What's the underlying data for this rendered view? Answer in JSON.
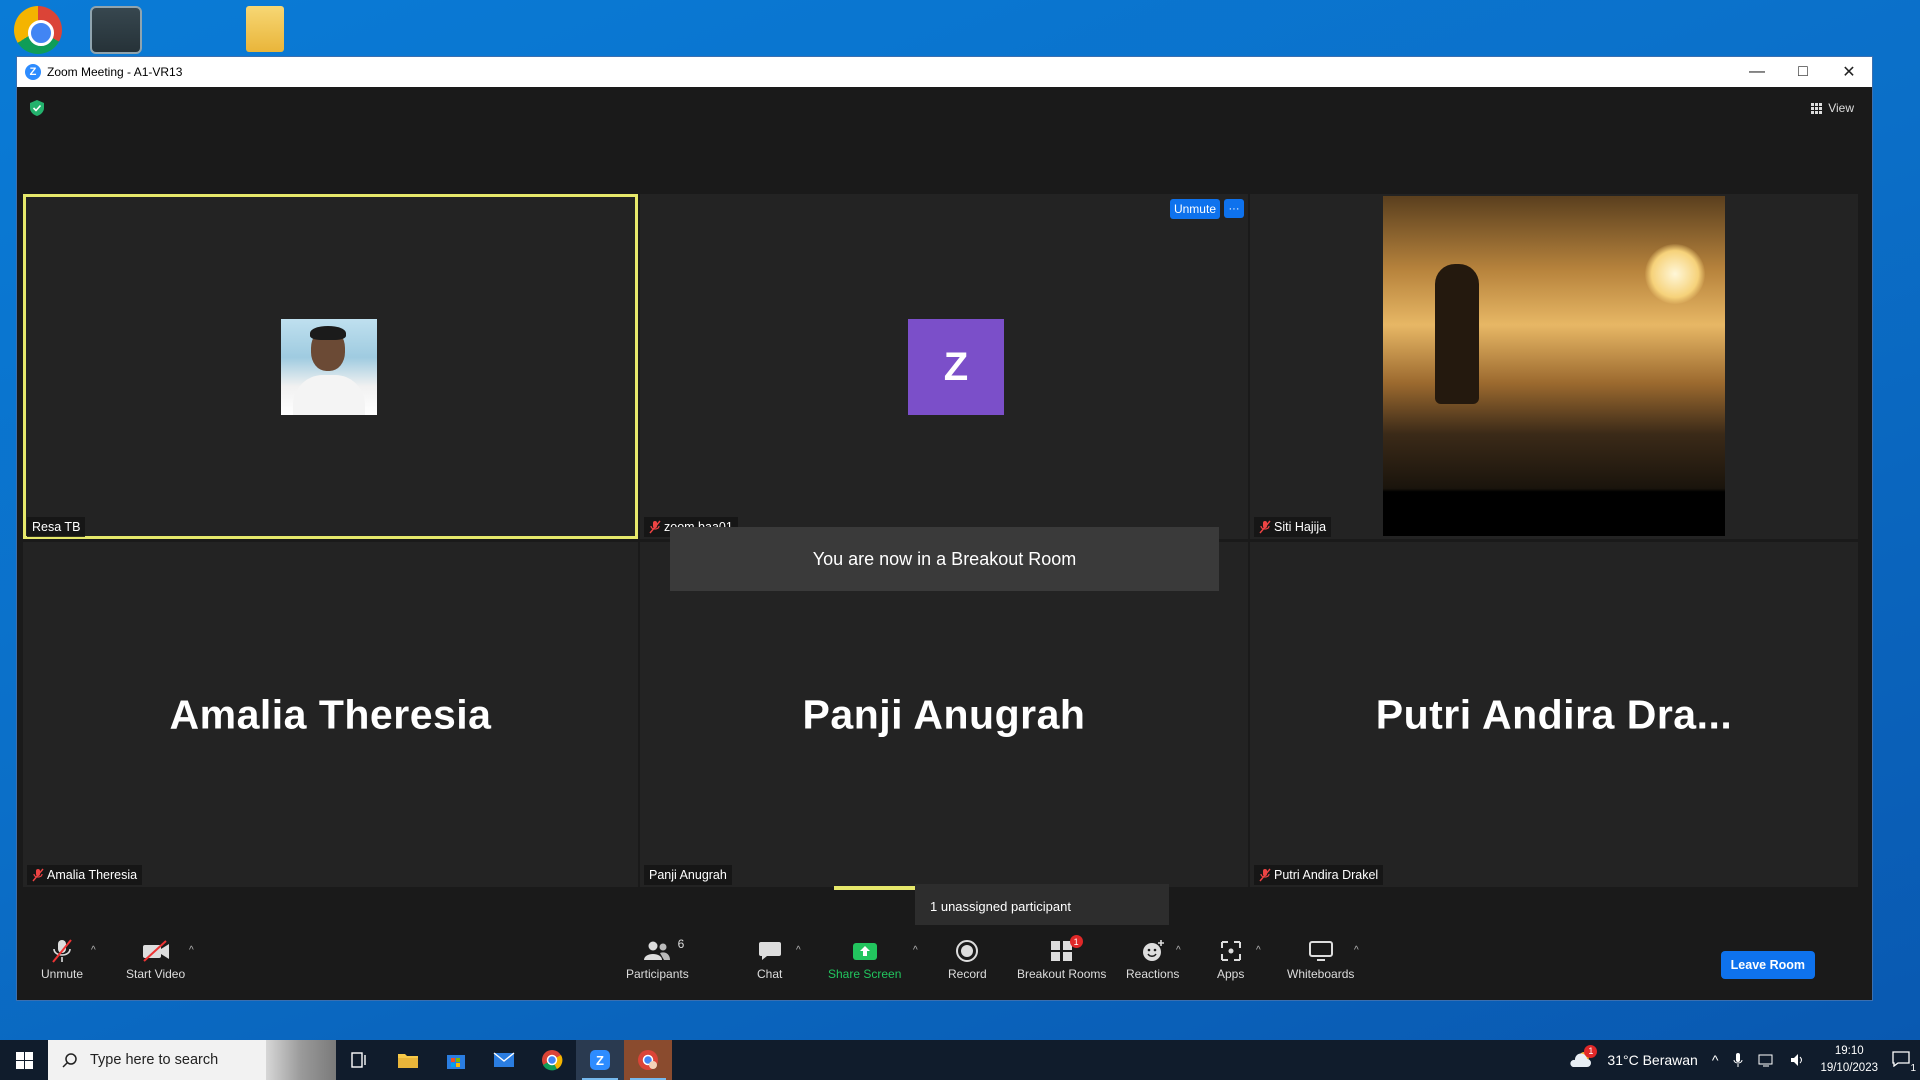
{
  "window": {
    "title": "Zoom Meeting - A1-VR13",
    "minimize": "—",
    "maximize": "□",
    "close": "✕"
  },
  "meeting": {
    "view_label": "View",
    "unmute_pill": "Unmute",
    "more_pill": "···",
    "toast": "You are now in a Breakout Room",
    "unassigned_tip": "1 unassigned participant",
    "tiles": [
      {
        "name": "Resa TB",
        "muted": false,
        "active": true,
        "display": "photo"
      },
      {
        "name": "zoom baa01",
        "muted": true,
        "active": false,
        "display": "letter",
        "letter": "Z"
      },
      {
        "name": "Siti Hajija",
        "muted": true,
        "active": false,
        "display": "video"
      },
      {
        "name": "Amalia Theresia",
        "muted": true,
        "active": false,
        "display": "name",
        "big_name": "Amalia Theresia"
      },
      {
        "name": "Panji Anugrah",
        "muted": false,
        "active": false,
        "display": "name",
        "big_name": "Panji Anugrah"
      },
      {
        "name": "Putri Andira Drakel",
        "muted": true,
        "active": false,
        "display": "name",
        "big_name": "Putri Andira Dra..."
      }
    ]
  },
  "toolbar": {
    "unmute": "Unmute",
    "start_video": "Start Video",
    "participants": "Participants",
    "participants_count": "6",
    "chat": "Chat",
    "share_screen": "Share Screen",
    "record": "Record",
    "breakout_rooms": "Breakout Rooms",
    "breakout_badge": "1",
    "reactions": "Reactions",
    "apps": "Apps",
    "whiteboards": "Whiteboards",
    "leave_room": "Leave Room"
  },
  "taskbar": {
    "search_placeholder": "Type here to search",
    "weather": "31°C  Berawan",
    "weather_badge": "1",
    "time": "19:10",
    "date": "19/10/2023",
    "notification_count": "1"
  },
  "colors": {
    "zoom_blue": "#0e72ed",
    "active_speaker": "#e6e86b",
    "avatar_purple": "#7b4fc9",
    "share_green": "#22c55e",
    "badge_red": "#e02828"
  }
}
